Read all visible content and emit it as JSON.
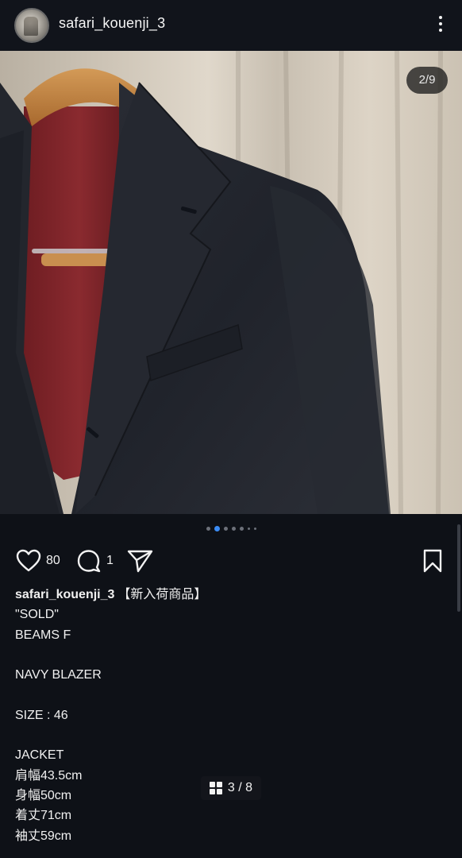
{
  "post": {
    "username": "safari_kouenji_3",
    "media_counter": "2/9",
    "carousel": {
      "dot_count": 7,
      "active_index": 1
    }
  },
  "actions": {
    "like_count": "80",
    "comment_count": "1",
    "icons": [
      "heart-icon",
      "comment-icon",
      "send-icon",
      "bookmark-icon"
    ]
  },
  "caption": {
    "username": "safari_kouenji_3",
    "lines": [
      "【新入荷商品】",
      "\"SOLD\"",
      "BEAMS F",
      "",
      "NAVY BLAZER",
      "",
      "SIZE : 46",
      "",
      "JACKET",
      "肩幅43.5cm",
      "身幅50cm",
      "着丈71cm",
      "袖丈59cm"
    ]
  },
  "overlay": {
    "page_indicator": "3 / 8"
  },
  "colors": {
    "background": "#0e1117",
    "accent_dot": "#3b8cf5",
    "text": "#f2f2f2"
  }
}
